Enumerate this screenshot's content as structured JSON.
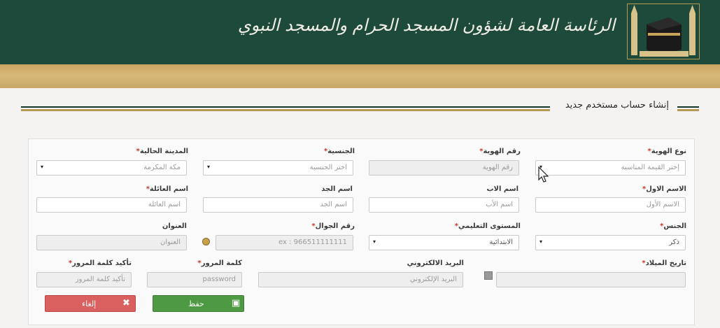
{
  "header": {
    "title": "الرئاسة العامة لشؤون المسجد الحرام والمسجد النبوي",
    "colors": {
      "green": "#1d4a3a",
      "gold": "#c8a561"
    }
  },
  "page_title": "إنشاء حساب مستخدم جديد",
  "form": {
    "row1": {
      "id_type": {
        "label": "نوع الهوية",
        "required": true,
        "value": "إختر القيمة المناسبة"
      },
      "id_number": {
        "label": "رقم الهوية",
        "required": true,
        "placeholder": "رقم الهوية"
      },
      "nationality": {
        "label": "الجنسية",
        "required": true,
        "value": "اختر الجنسية"
      },
      "current_city": {
        "label": "المدينة الحالية",
        "required": true,
        "value": "مكة المكرمة"
      }
    },
    "row2": {
      "first_name": {
        "label": "الاسم الاول",
        "required": true,
        "placeholder": "الاسم الأول"
      },
      "father_name": {
        "label": "اسم الاب",
        "required": false,
        "placeholder": "اسم الأب"
      },
      "grandfather_name": {
        "label": "اسم الجد",
        "required": false,
        "placeholder": "اسم الجد"
      },
      "family_name": {
        "label": "اسم العائلة",
        "required": true,
        "placeholder": "اسم العائلة"
      }
    },
    "row3": {
      "gender": {
        "label": "الجنس",
        "required": true,
        "value": "ذكر"
      },
      "education": {
        "label": "المستوى التعليمي",
        "required": true,
        "value": "الابتدائية"
      },
      "mobile": {
        "label": "رقم الجوال",
        "required": true,
        "placeholder": "ex : 966511111111"
      },
      "address": {
        "label": "العنوان",
        "required": false,
        "placeholder": "العنوان"
      }
    },
    "row4": {
      "birth_date": {
        "label": "تاريخ الميلاد",
        "required": true,
        "value": ""
      },
      "email": {
        "label": "البريد الالكتروني",
        "required": false,
        "placeholder": "البريد الإلكتروني"
      },
      "password": {
        "label": "كلمة المرور",
        "required": true,
        "placeholder": "password"
      },
      "confirm_password": {
        "label": "تأكيد كلمة المرور",
        "required": true,
        "placeholder": "تأكيد كلمة المرور"
      }
    },
    "required_mark": "*"
  },
  "buttons": {
    "save": {
      "label": "حفظ",
      "icon": "save-icon",
      "color": "#4e9a44"
    },
    "cancel": {
      "label": "إلغاء",
      "icon": "close-icon",
      "color": "#d9605f"
    }
  },
  "icons": {
    "dropdown_caret": "▾",
    "save_glyph": "▣",
    "cancel_glyph": "✖"
  }
}
